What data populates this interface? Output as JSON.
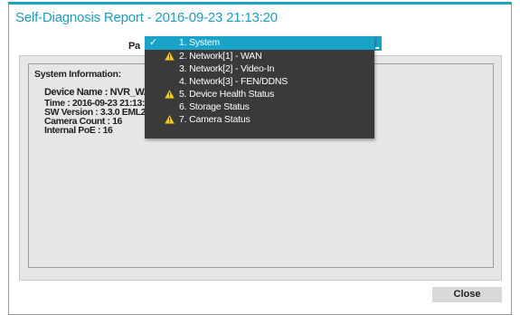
{
  "dialog": {
    "title": "Self-Diagnosis Report - 2016-09-23 21:13:20",
    "page_label": "Pa",
    "close_label": "Close"
  },
  "report": {
    "heading": "System Information:",
    "lines": [
      "Device Name : NVR_WAN_",
      "Time : 2016-09-23 21:13:20",
      "SW Version : 3.3.0 EML200",
      "Camera Count : 16",
      "Internal PoE : 16"
    ]
  },
  "dropdown": {
    "selected_index": 0,
    "items": [
      {
        "label": "1. System",
        "selected": true,
        "warning": false
      },
      {
        "label": "2. Network[1] - WAN",
        "selected": false,
        "warning": true
      },
      {
        "label": "3. Network[2] - Video-In",
        "selected": false,
        "warning": false
      },
      {
        "label": "4. Network[3] - FEN/DDNS",
        "selected": false,
        "warning": false
      },
      {
        "label": "5. Device Health Status",
        "selected": false,
        "warning": true
      },
      {
        "label": "6. Storage Status",
        "selected": false,
        "warning": false
      },
      {
        "label": "7. Camera Status",
        "selected": false,
        "warning": true
      }
    ]
  },
  "colors": {
    "accent": "#1aa3c9",
    "menu_bg": "#3a3a3a",
    "warning": "#f5d020"
  },
  "icons": {
    "check": "checkmark-icon",
    "warning": "warning-icon"
  }
}
